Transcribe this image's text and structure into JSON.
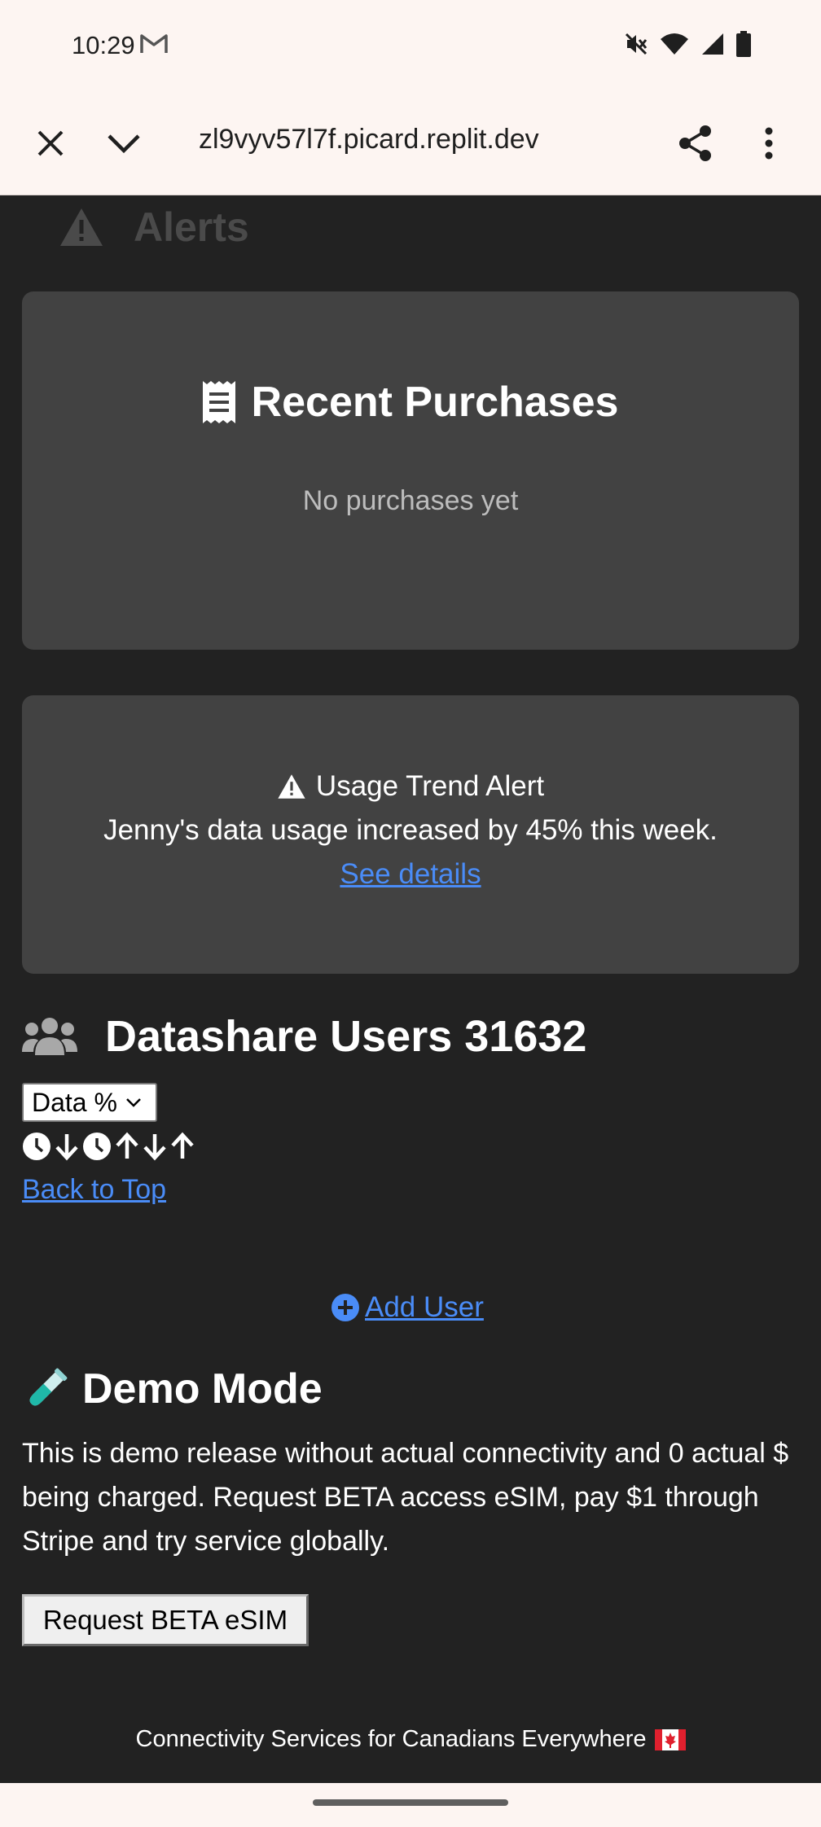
{
  "status_bar": {
    "time": "10:29"
  },
  "browser": {
    "url": "zl9vyv57l7f.picard.replit.dev"
  },
  "alerts_section": {
    "title": "Alerts"
  },
  "recent_purchases": {
    "title": "Recent Purchases",
    "empty_text": "No purchases yet"
  },
  "usage_alert": {
    "title": "Usage Trend Alert",
    "body": "Jenny's data usage increased by 45% this week.",
    "link": "See details"
  },
  "datashare": {
    "title": "Datashare Users 31632",
    "sort_select": {
      "selected": "Data %"
    },
    "back_to_top": "Back to Top",
    "add_user": "Add User"
  },
  "demo_mode": {
    "title": "Demo Mode",
    "body": "This is demo release without actual connectivity and 0 actual $ being charged. Request BETA access eSIM, pay $1 through Stripe and try service globally.",
    "button": "Request BETA eSIM"
  },
  "footer": {
    "text": "Connectivity Services for Canadians Everywhere"
  },
  "colors": {
    "page_bg": "#222222",
    "card_bg": "#424242",
    "link": "#4a8cf7",
    "chrome_bg": "#fdf5f2"
  },
  "icons": [
    "gmail-icon",
    "mute-icon",
    "wifi-icon",
    "signal-icon",
    "battery-icon",
    "close-icon",
    "chevron-down-icon",
    "share-icon",
    "more-vert-icon",
    "warning-icon",
    "receipt-icon",
    "users-icon",
    "clock-icon",
    "arrow-down-icon",
    "arrow-up-icon",
    "plus-circle-icon",
    "test-tube-icon",
    "canada-flag-icon"
  ]
}
